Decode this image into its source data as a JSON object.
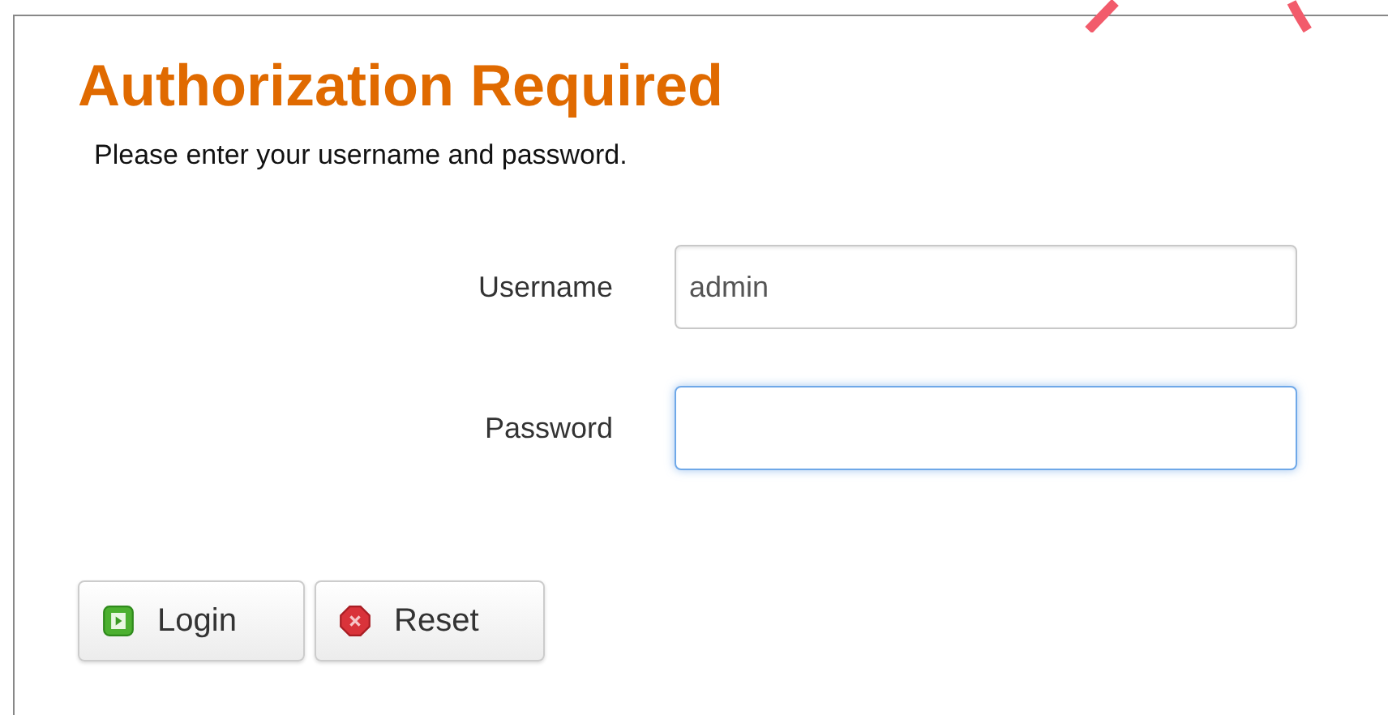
{
  "title": "Authorization Required",
  "description": "Please enter your username and password.",
  "fields": [
    {
      "label": "Username",
      "value": "admin",
      "focused": false
    },
    {
      "label": "Password",
      "focused": true
    }
  ],
  "buttons": [
    {
      "label": "Login",
      "kind": "login"
    },
    {
      "label": "Reset",
      "kind": "reset"
    }
  ]
}
